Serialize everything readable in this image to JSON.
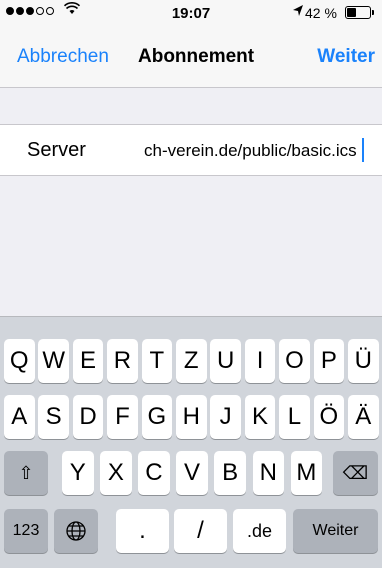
{
  "status_bar": {
    "time": "19:07",
    "battery_text": "42 %",
    "battery_level_pct": 42,
    "wifi_icon": "wifi-icon",
    "location_icon": "location-arrow-icon"
  },
  "nav": {
    "cancel_label": "Abbrechen",
    "title": "Abonnement",
    "next_label": "Weiter"
  },
  "form": {
    "server_label": "Server",
    "server_value": "ch-verein.de/public/basic.ics"
  },
  "keyboard": {
    "row1": [
      "Q",
      "W",
      "E",
      "R",
      "T",
      "Z",
      "U",
      "I",
      "O",
      "P",
      "Ü"
    ],
    "row2": [
      "A",
      "S",
      "D",
      "F",
      "G",
      "H",
      "J",
      "K",
      "L",
      "Ö",
      "Ä"
    ],
    "row3": [
      "Y",
      "X",
      "C",
      "V",
      "B",
      "N",
      "M"
    ],
    "shift_icon": "⇧",
    "delete_icon": "⌫",
    "numbers_label": "123",
    "globe_icon": "🌐",
    "dot_label": ".",
    "slash_label": "/",
    "de_label": ".de",
    "return_label": "Weiter"
  },
  "colors": {
    "accent": "#1a82fb",
    "background": "#efeff4",
    "keyboard_bg": "#d1d5db"
  }
}
